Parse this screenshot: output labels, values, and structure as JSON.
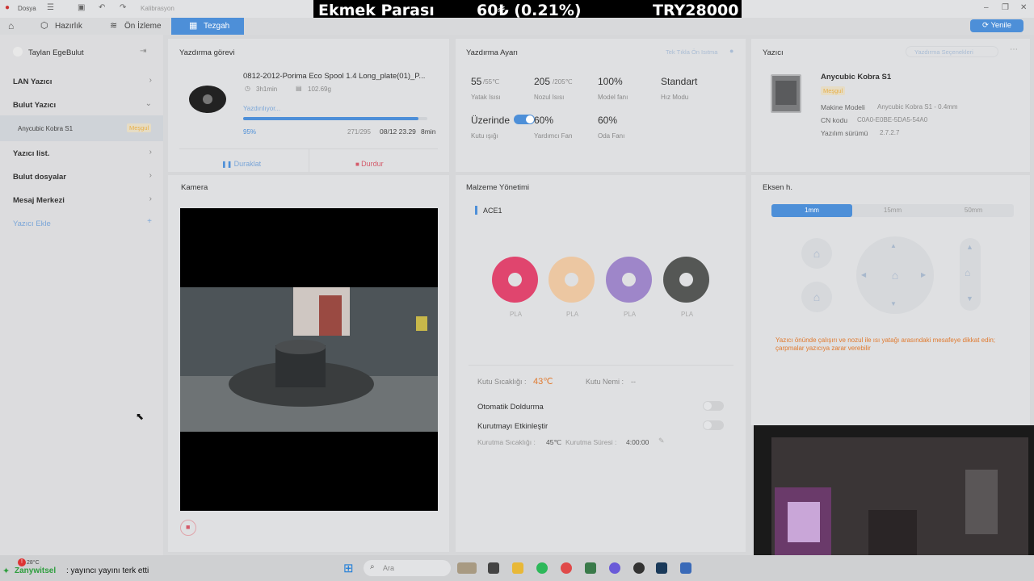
{
  "titlebar": {
    "file_menu": "Dosya",
    "calibration": "Kalibrasyon"
  },
  "overlay": {
    "label": "Ekmek Parası",
    "percent": "60₺ (0.21%)",
    "amount": "TRY28000"
  },
  "nav": {
    "tabs": [
      "Hazırlık",
      "Ön İzleme",
      "Tezgah"
    ],
    "refresh": "Yenile"
  },
  "sidebar": {
    "user": "Taylan EgeBulut",
    "lan": "LAN Yazıcı",
    "cloud": "Bulut Yazıcı",
    "printer_name": "Anycubic Kobra S1",
    "printer_badge": "Meşgul",
    "printer_list": "Yazıcı list.",
    "cloud_files": "Bulut dosyalar",
    "messages": "Mesaj Merkezi",
    "add_printer": "Yazıcı Ekle"
  },
  "task": {
    "title": "Yazdırma görevi",
    "filename": "0812-2012-Porima Eco Spool 1.4 Long_plate(01)_P...",
    "duration": "3h1min",
    "weight": "102.69g",
    "status": "Yazdırılıyor...",
    "progress": 0.95,
    "progress_text": "95%",
    "layers": "271/295",
    "eta": "08/12 23.29",
    "remaining": "8min",
    "pause": "Duraklat",
    "stop": "Durdur"
  },
  "settings": {
    "title": "Yazdırma Ayarı",
    "link": "Tek Tıkla Ön Isıtma",
    "bed_temp": "55",
    "bed_target": "/55℃",
    "bed_label": "Yatak Isısı",
    "nozzle_temp": "205",
    "nozzle_target": "/205℃",
    "nozzle_label": "Nozul Isısı",
    "model_fan": "100%",
    "model_fan_label": "Model fanı",
    "speed_mode": "Standart",
    "speed_label": "Hız Modu",
    "box_light": "Üzerinde",
    "box_light_label": "Kutu ışığı",
    "aux_fan": "60%",
    "aux_fan_label": "Yardımcı Fan",
    "room_fan": "60%",
    "room_fan_label": "Oda Fanı"
  },
  "printer": {
    "title": "Yazıcı",
    "select_label": "Yazdırma Seçenekleri",
    "name": "Anycubic Kobra S1",
    "status": "Meşgul",
    "model_label": "Makine Modeli",
    "model_value": "Anycubic Kobra S1 - 0.4mm",
    "cn_label": "CN kodu",
    "cn_value": "C0A0-E0BE-5DA5-54A0",
    "fw_label": "Yazılım sürümü",
    "fw_value": "2.7.2.7"
  },
  "camera": {
    "title": "Kamera"
  },
  "material": {
    "title": "Malzeme Yönetimi",
    "ace": "ACE1",
    "spools": [
      {
        "type": "PLA",
        "color": "#e0456e"
      },
      {
        "type": "PLA",
        "color": "#ecc7a2"
      },
      {
        "type": "PLA",
        "color": "#9e86c9"
      },
      {
        "type": "PLA",
        "color": "#555755"
      }
    ],
    "box_temp_label": "Kutu Sıcaklığı :",
    "box_temp": "43℃",
    "box_humidity_label": "Kutu Nemi :",
    "box_humidity": "--",
    "auto_refill": "Otomatik Doldurma",
    "enable_drying": "Kurutmayı Etkinleştir",
    "drying_temp_label": "Kurutma Sıcaklığı :",
    "drying_temp": "45℃",
    "drying_time_label": "Kurutma Süresi :",
    "drying_time": "4:00:00"
  },
  "axis": {
    "title": "Eksen h.",
    "steps": [
      "1mm",
      "15mm",
      "50mm"
    ],
    "warning": "Yazıcı önünde çalışırı ve nozul ile ısı yatağı arasındaki mesafeye dikkat edin; çarpmalar yazıcıya zarar verebilir"
  },
  "chat": {
    "user": "Zanywitsel",
    "message": ": yayıncı yayını terk etti",
    "weather": "28°C"
  },
  "taskbar": {
    "search": "Ara"
  },
  "colors": {
    "accent": "#4d8fd8",
    "warning": "#e07a2f",
    "busy_badge": "#e8b04a"
  }
}
